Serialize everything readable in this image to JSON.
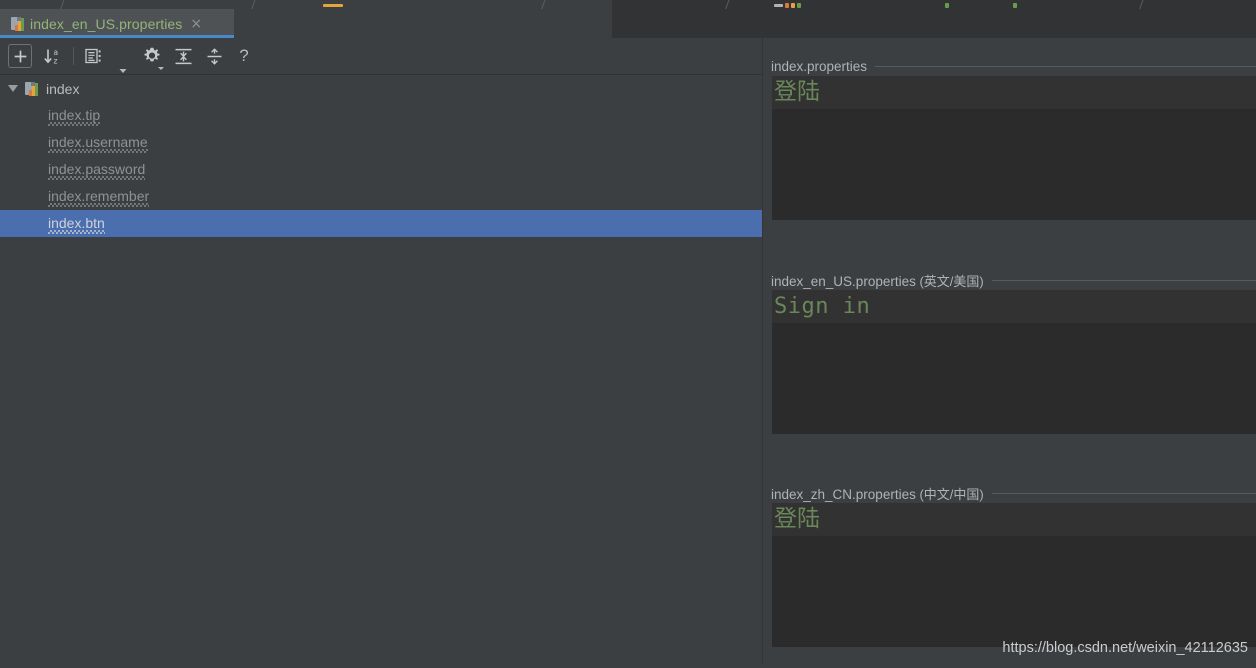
{
  "window": {
    "theme_colors": {
      "background": "#3c3f41",
      "editor_background": "#2b2b2b",
      "caret_line": "#323232",
      "selection_blue": "#4b6eaf",
      "tab_underline": "#4a88c7",
      "string_green": "#6a8759",
      "tab_label_green": "#94b47a",
      "text_grey": "#a9b7c6"
    }
  },
  "tab": {
    "label": "index_en_US.properties",
    "close": "×",
    "icon": "properties-file-icon"
  },
  "toolbar": {
    "buttons": [
      {
        "name": "add-property-button",
        "tooltip": "Add",
        "glyph": "+"
      },
      {
        "name": "sort-az-button",
        "tooltip": "Sort a-z",
        "glyph": "↓az"
      },
      {
        "name": "group-by-button",
        "tooltip": "Group",
        "glyph": "list"
      },
      {
        "name": "extra-dropdown-button",
        "tooltip": "More",
        "glyph": "▾"
      },
      {
        "name": "settings-button",
        "tooltip": "Settings",
        "glyph": "gear"
      },
      {
        "name": "expand-all-button",
        "tooltip": "Expand All",
        "glyph": "expand"
      },
      {
        "name": "collapse-all-button",
        "tooltip": "Collapse All",
        "glyph": "collapse"
      },
      {
        "name": "help-button",
        "tooltip": "Help",
        "glyph": "?"
      }
    ],
    "help_label": "?"
  },
  "tree": {
    "root": {
      "label": "index",
      "expanded": true
    },
    "items": [
      {
        "label": "index.tip",
        "selected": false,
        "misspelled": true
      },
      {
        "label": "index.username",
        "selected": false,
        "misspelled": true
      },
      {
        "label": "index.password",
        "selected": false,
        "misspelled": true
      },
      {
        "label": "index.remember",
        "selected": false,
        "misspelled": true
      },
      {
        "label": "index.btn",
        "selected": true,
        "misspelled": true
      }
    ]
  },
  "panels": [
    {
      "name": "default-locale-panel",
      "title": "index.properties",
      "locale": "",
      "value": "登陆",
      "font": "cjk"
    },
    {
      "name": "en-us-locale-panel",
      "title": "index_en_US.properties",
      "locale": " (英文/美国)",
      "value": "Sign in",
      "font": "mono"
    },
    {
      "name": "zh-cn-locale-panel",
      "title": "index_zh_CN.properties",
      "locale": " (中文/中国)",
      "value": "登陆",
      "font": "cjk"
    }
  ],
  "watermark": {
    "text": "https://blog.csdn.net/weixin_42112635"
  }
}
